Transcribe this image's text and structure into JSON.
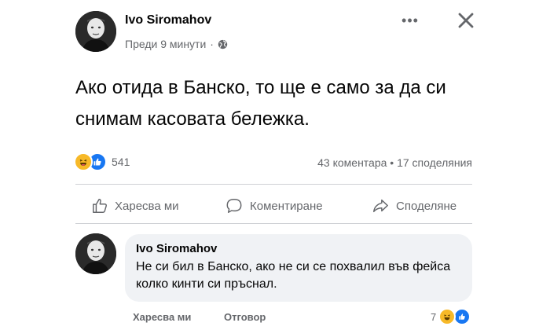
{
  "post": {
    "author": "Ivo Siromahov",
    "time": "Преди 9 минути",
    "meta_separator": "·",
    "text": "Ако отида в Банско, то ще е само за да си снимам касовата бележка.",
    "more_label": "•••"
  },
  "stats": {
    "reaction_count": "541",
    "comments_shares": "43 коментара • 17 споделяния",
    "reaction_icons": [
      "haha-icon",
      "like-icon"
    ]
  },
  "actions": {
    "like": "Харесва ми",
    "comment": "Коментиране",
    "share": "Споделяне"
  },
  "comment": {
    "author": "Ivo Siromahov",
    "text": "Не си бил в Банско, ако не си се похвалил във фейса колко кинти си пръснал.",
    "like_label": "Харесва ми",
    "reply_label": "Отговор",
    "reaction_count": "7",
    "reaction_icons": [
      "haha-icon",
      "like-icon"
    ]
  },
  "colors": {
    "like_blue": "#1877f2",
    "haha_yellow": "#f7b928",
    "secondary_text": "#65676b",
    "bubble_bg": "#f0f2f5"
  }
}
